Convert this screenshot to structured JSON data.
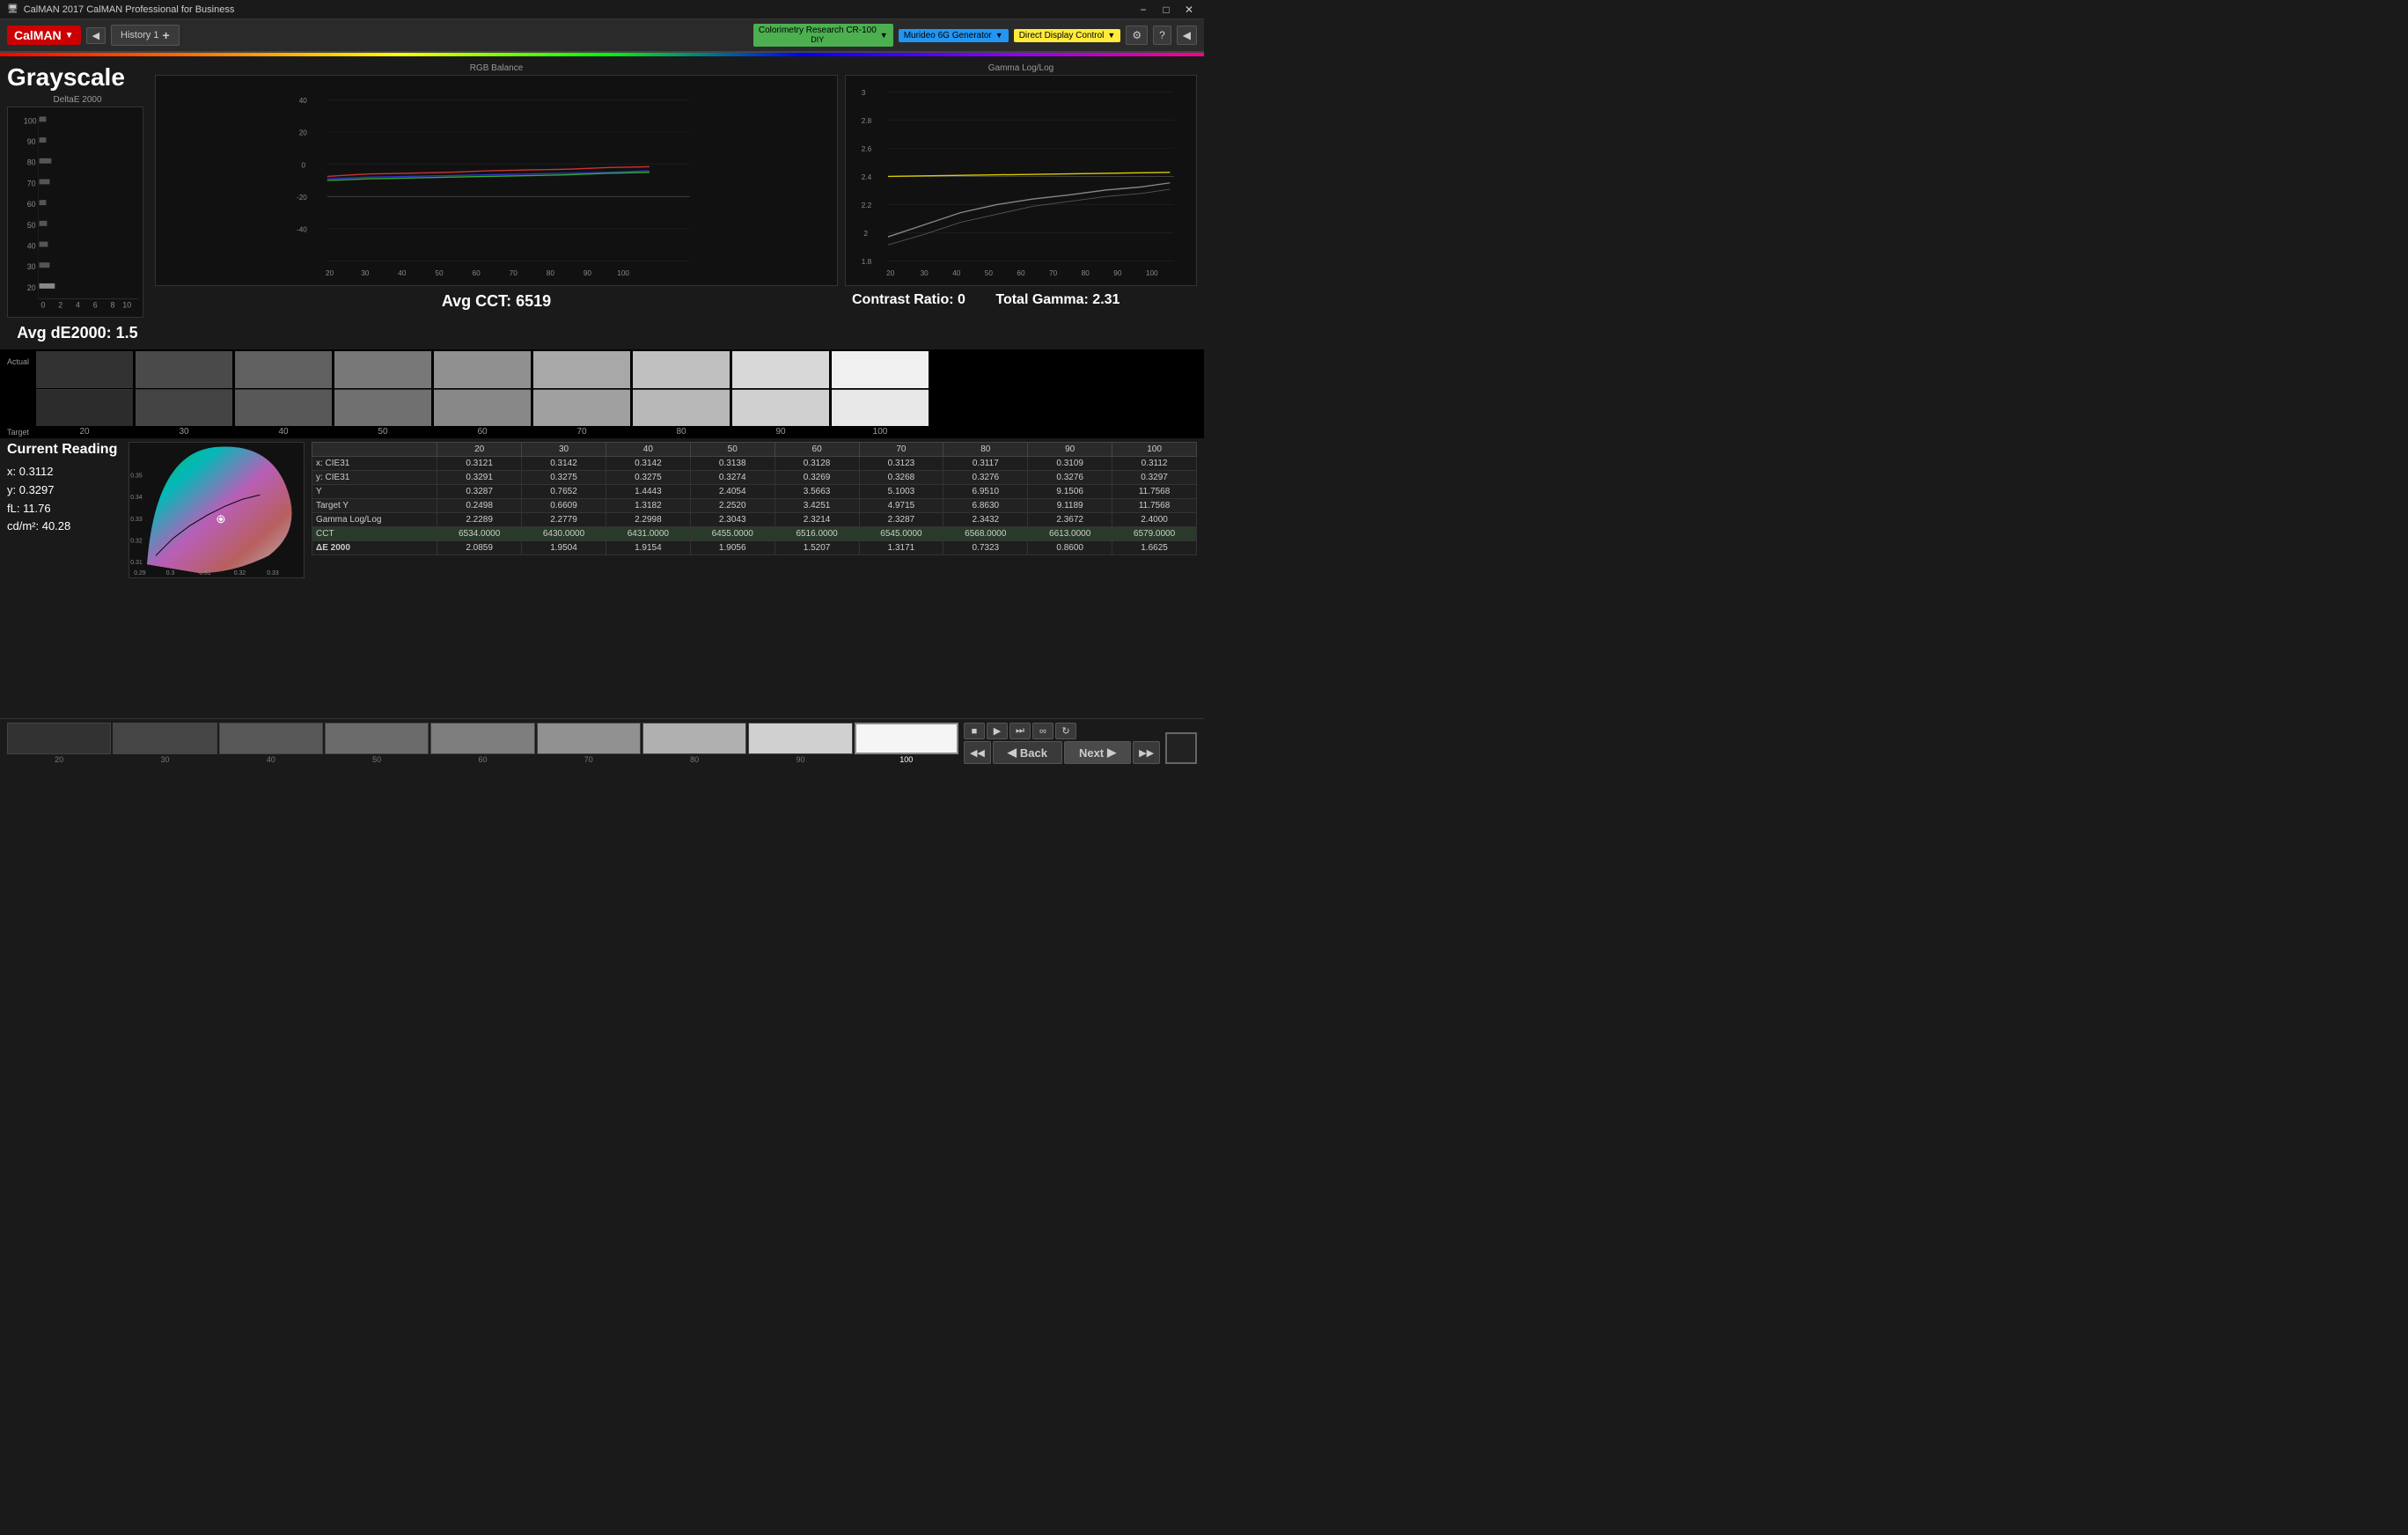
{
  "titlebar": {
    "title": "CalMAN 2017 CalMAN Professional for Business",
    "minimize": "−",
    "maximize": "□",
    "close": "✕"
  },
  "toolbar": {
    "logo": "CalMAN",
    "nav_back": "◀",
    "tab_name": "History 1",
    "tab_add": "+",
    "devices": [
      {
        "label": "Colorimetry Research CR-100",
        "sublabel": "DIY",
        "color": "green"
      },
      {
        "label": "Murideo 6G Generator",
        "color": "blue"
      },
      {
        "label": "Direct Display Control",
        "color": "yellow"
      }
    ],
    "settings_icon": "⚙",
    "help_icon": "?",
    "arrow_icon": "◀"
  },
  "grayscale": {
    "title": "Grayscale",
    "deltaE_title": "DeltaE 2000",
    "avg_dE": "Avg dE2000: 1.5",
    "avg_cct": "Avg CCT: 6519",
    "contrast_ratio": "Contrast Ratio: 0",
    "total_gamma": "Total Gamma: 2.31"
  },
  "charts": {
    "rgb_balance_title": "RGB Balance",
    "gamma_title": "Gamma Log/Log"
  },
  "current_reading": {
    "title": "Current Reading",
    "x": "x: 0.3112",
    "y": "y: 0.3297",
    "fL": "fL: 11.76",
    "cd": "cd/m²: 40.28"
  },
  "data_table": {
    "headers": [
      "",
      "20",
      "30",
      "40",
      "50",
      "60",
      "70",
      "80",
      "90",
      "100"
    ],
    "rows": [
      {
        "label": "x: CIE31",
        "values": [
          "0.3121",
          "0.3142",
          "0.3142",
          "0.3138",
          "0.3128",
          "0.3123",
          "0.3117",
          "0.3109",
          "0.3112"
        ]
      },
      {
        "label": "y: CIE31",
        "values": [
          "0.3291",
          "0.3275",
          "0.3275",
          "0.3274",
          "0.3269",
          "0.3268",
          "0.3276",
          "0.3276",
          "0.3297"
        ]
      },
      {
        "label": "Y",
        "values": [
          "0.3287",
          "0.7652",
          "1.4443",
          "2.4054",
          "3.5663",
          "5.1003",
          "6.9510",
          "9.1506",
          "11.7568"
        ]
      },
      {
        "label": "Target Y",
        "values": [
          "0.2498",
          "0.6609",
          "1.3182",
          "2.2520",
          "3.4251",
          "4.9715",
          "6.8630",
          "9.1189",
          "11.7568"
        ]
      },
      {
        "label": "Gamma Log/Log",
        "values": [
          "2.2289",
          "2.2779",
          "2.2998",
          "2.3043",
          "2.3214",
          "2.3287",
          "2.3432",
          "2.3672",
          "2.4000"
        ]
      },
      {
        "label": "CCT",
        "values": [
          "6534.0000",
          "6430.0000",
          "6431.0000",
          "6455.0000",
          "6516.0000",
          "6545.0000",
          "6568.0000",
          "6613.0000",
          "6579.0000"
        ]
      },
      {
        "label": "ΔE 2000",
        "values": [
          "2.0859",
          "1.9504",
          "1.9154",
          "1.9056",
          "1.5207",
          "1.3171",
          "0.7323",
          "0.8600",
          "1.6625"
        ]
      }
    ]
  },
  "swatches": {
    "values": [
      20,
      30,
      40,
      50,
      60,
      70,
      80,
      90,
      100
    ],
    "colors": [
      "#323232",
      "#4a4a4a",
      "#606060",
      "#787878",
      "#909090",
      "#a8a8a8",
      "#c0c0c0",
      "#d8d8d8",
      "#f0f0f0"
    ]
  },
  "bottom_swatches": {
    "values": [
      20,
      30,
      40,
      50,
      60,
      70,
      80,
      90,
      100
    ],
    "colors": [
      "#323232",
      "#454545",
      "#585858",
      "#6b6b6b",
      "#7e7e7e",
      "#919191",
      "#b0b0b0",
      "#d0d0d0",
      "#f5f5f5"
    ],
    "selected": 9
  },
  "navigation": {
    "back_label": "Back",
    "next_label": "Next",
    "back_arrow": "◀",
    "next_arrow": "▶",
    "back_double": "◀◀",
    "next_double": "▶▶"
  }
}
